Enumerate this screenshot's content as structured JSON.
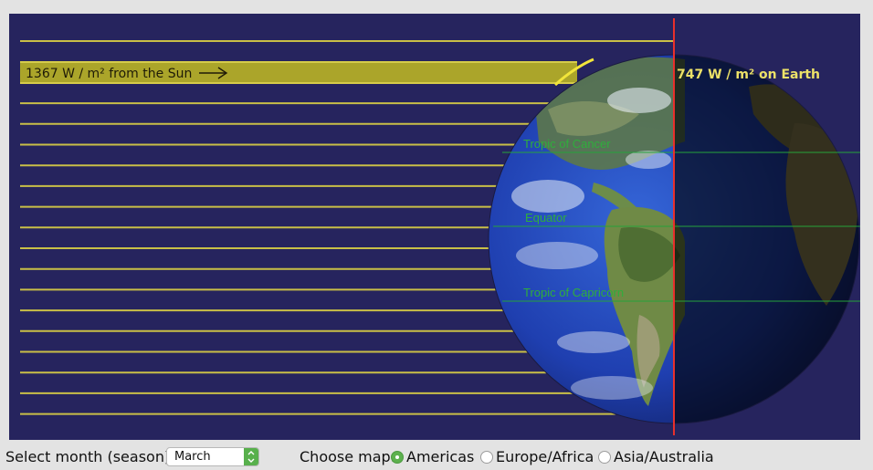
{
  "simulation": {
    "sun_label": "1367 W / m² from the Sun",
    "earth_label": "747 W / m² on Earth",
    "tropic_cancer": "Tropic of Cancer",
    "equator": "Equator",
    "tropic_capricorn": "Tropic of Capricorn",
    "colors": {
      "background": "#26245e",
      "sun_ray": "#c9bf47",
      "sun_beam": "#aba52a",
      "terminator": "#e8302c",
      "latitude_line": "#26a33b"
    }
  },
  "controls": {
    "month_label": "Select month (season):",
    "month_value": "March",
    "map_label": "Choose map:",
    "map_options": [
      {
        "label": "Americas",
        "selected": true
      },
      {
        "label": "Europe/Africa",
        "selected": false
      },
      {
        "label": "Asia/Australia",
        "selected": false
      }
    ]
  }
}
